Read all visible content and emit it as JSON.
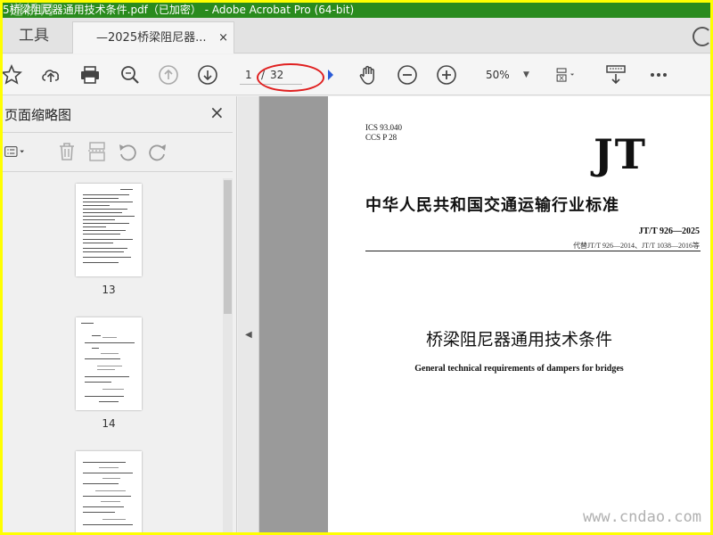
{
  "window": {
    "title": "5桥梁阻尼器通用技术条件.pdf（已加密） - Adobe Acrobat Pro (64-bit)",
    "watermark_top": "道桥网"
  },
  "tabs": {
    "tools_label": "工具",
    "doc_label": "—2025桥梁阻尼器...",
    "close_glyph": "×"
  },
  "toolbar": {
    "page_current": "1",
    "page_separator": "/",
    "page_total": "32",
    "zoom_value": "50%",
    "dropdown_glyph": "▼"
  },
  "sidepanel": {
    "title": "页面缩略图",
    "close_glyph": "×",
    "thumbnails": [
      {
        "page": "13"
      },
      {
        "page": "14"
      },
      {
        "page": ""
      }
    ]
  },
  "document": {
    "ics": "ICS 93.040",
    "ccs": "CCS P 28",
    "logo": "JT",
    "industry_standard": "中华人民共和国交通运输行业标准",
    "code": "JT/T  926—2025",
    "replaces": "代替JT/T 926—2014、JT/T 1038—2016等",
    "title_cn": "桥梁阻尼器通用技术条件",
    "title_en": "General technical requirements of dampers for bridges",
    "watermark": "www.cndao.com"
  },
  "colors": {
    "titlebar": "#2a8b1e",
    "border": "#ffff00",
    "annotation": "#e02020"
  }
}
